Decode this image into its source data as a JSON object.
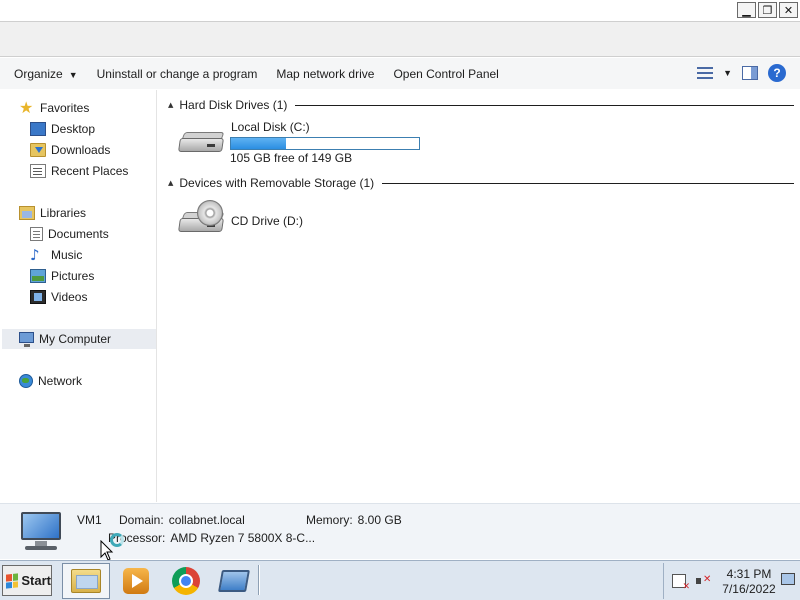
{
  "window": {
    "controls": {
      "minimize": "▁",
      "restore": "❐",
      "close": "✕"
    }
  },
  "toolbar": {
    "organize": "Organize",
    "uninstall": "Uninstall or change a program",
    "map_network_drive": "Map network drive",
    "open_control_panel": "Open Control Panel",
    "help": "?"
  },
  "sidebar": {
    "favorites": {
      "label": "Favorites",
      "icon": "star-icon",
      "items": [
        {
          "label": "Desktop",
          "icon": "desktop-icon"
        },
        {
          "label": "Downloads",
          "icon": "downloads-folder-icon"
        },
        {
          "label": "Recent Places",
          "icon": "recent-places-icon"
        }
      ]
    },
    "libraries": {
      "label": "Libraries",
      "icon": "libraries-icon",
      "items": [
        {
          "label": "Documents",
          "icon": "document-icon"
        },
        {
          "label": "Music",
          "icon": "music-icon"
        },
        {
          "label": "Pictures",
          "icon": "pictures-icon"
        },
        {
          "label": "Videos",
          "icon": "video-icon"
        }
      ]
    },
    "computer": {
      "label": "My Computer",
      "icon": "computer-icon",
      "selected": true
    },
    "network": {
      "label": "Network",
      "icon": "network-icon"
    }
  },
  "content": {
    "hard_disk_group": "Hard Disk Drives (1)",
    "removable_group": "Devices with Removable Storage (1)",
    "drives": [
      {
        "name": "Local Disk (C:)",
        "free_text": "105 GB free of 149 GB",
        "used_fraction": 0.295,
        "bar_color": "#2b8ee2"
      },
      {
        "name": "CD Drive (D:)"
      }
    ]
  },
  "details": {
    "computer_name": "VM1",
    "domain_label": "Domain:",
    "domain_value": "collabnet.local",
    "memory_label": "Memory:",
    "memory_value": "8.00 GB",
    "processor_label": "Processor:",
    "processor_value": "AMD Ryzen 7 5800X 8-C..."
  },
  "taskbar": {
    "start_label": "Start",
    "apps": [
      "windows-explorer-icon",
      "media-player-icon",
      "chrome-icon",
      "remote-desktop-icon"
    ],
    "clock_time": "4:31 PM",
    "clock_date": "7/16/2022"
  },
  "colors": {
    "accent": "#2b8ee2",
    "taskbar_bg": "#dde6f0",
    "selection_bg": "#e9ecf1"
  }
}
